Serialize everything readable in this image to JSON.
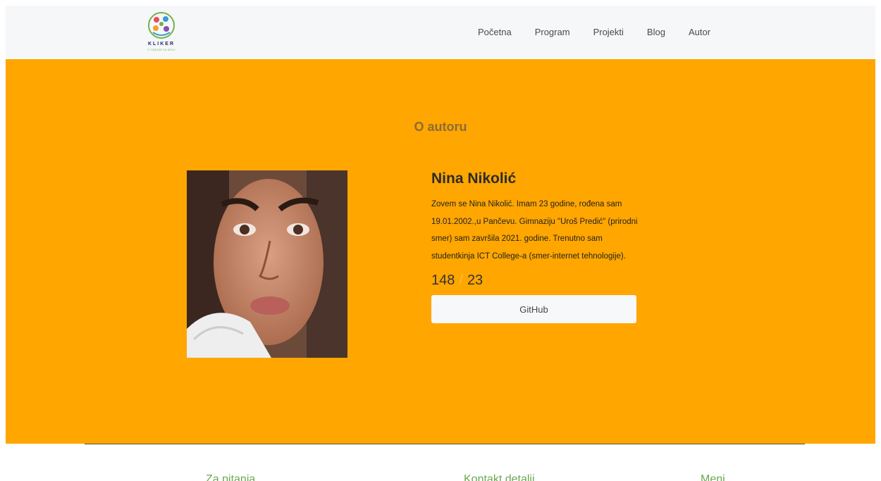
{
  "header": {
    "logo": {
      "name": "KLIKER",
      "tagline": "IT CENTAR ZA DECU"
    },
    "nav": [
      {
        "label": "Početna"
      },
      {
        "label": "Program"
      },
      {
        "label": "Projekti"
      },
      {
        "label": "Blog"
      },
      {
        "label": "Autor"
      }
    ]
  },
  "hero": {
    "section_title": "O autoru",
    "author_name": "Nina Nikolić",
    "bio": "Zovem se Nina Nikolić. Imam 23 godine, rođena sam 19.01.2002.,u Pančevu. Gimnaziju \"Uroš Predić\" (prirodni smer) sam završila 2021. godine. Trenutno sam studentkinja ICT College-a (smer-internet tehnologije).",
    "stats": {
      "first": "148",
      "separator": "/",
      "second": "23"
    },
    "button_label": "GitHub"
  },
  "footer": {
    "columns": [
      {
        "title": "Za pitanja"
      },
      {
        "title": "Kontakt detalji"
      },
      {
        "title": "Meni"
      }
    ]
  },
  "colors": {
    "hero_bg": "#ffa600",
    "navbar_bg": "#f6f7f8",
    "footer_heading": "#6aa84f"
  }
}
